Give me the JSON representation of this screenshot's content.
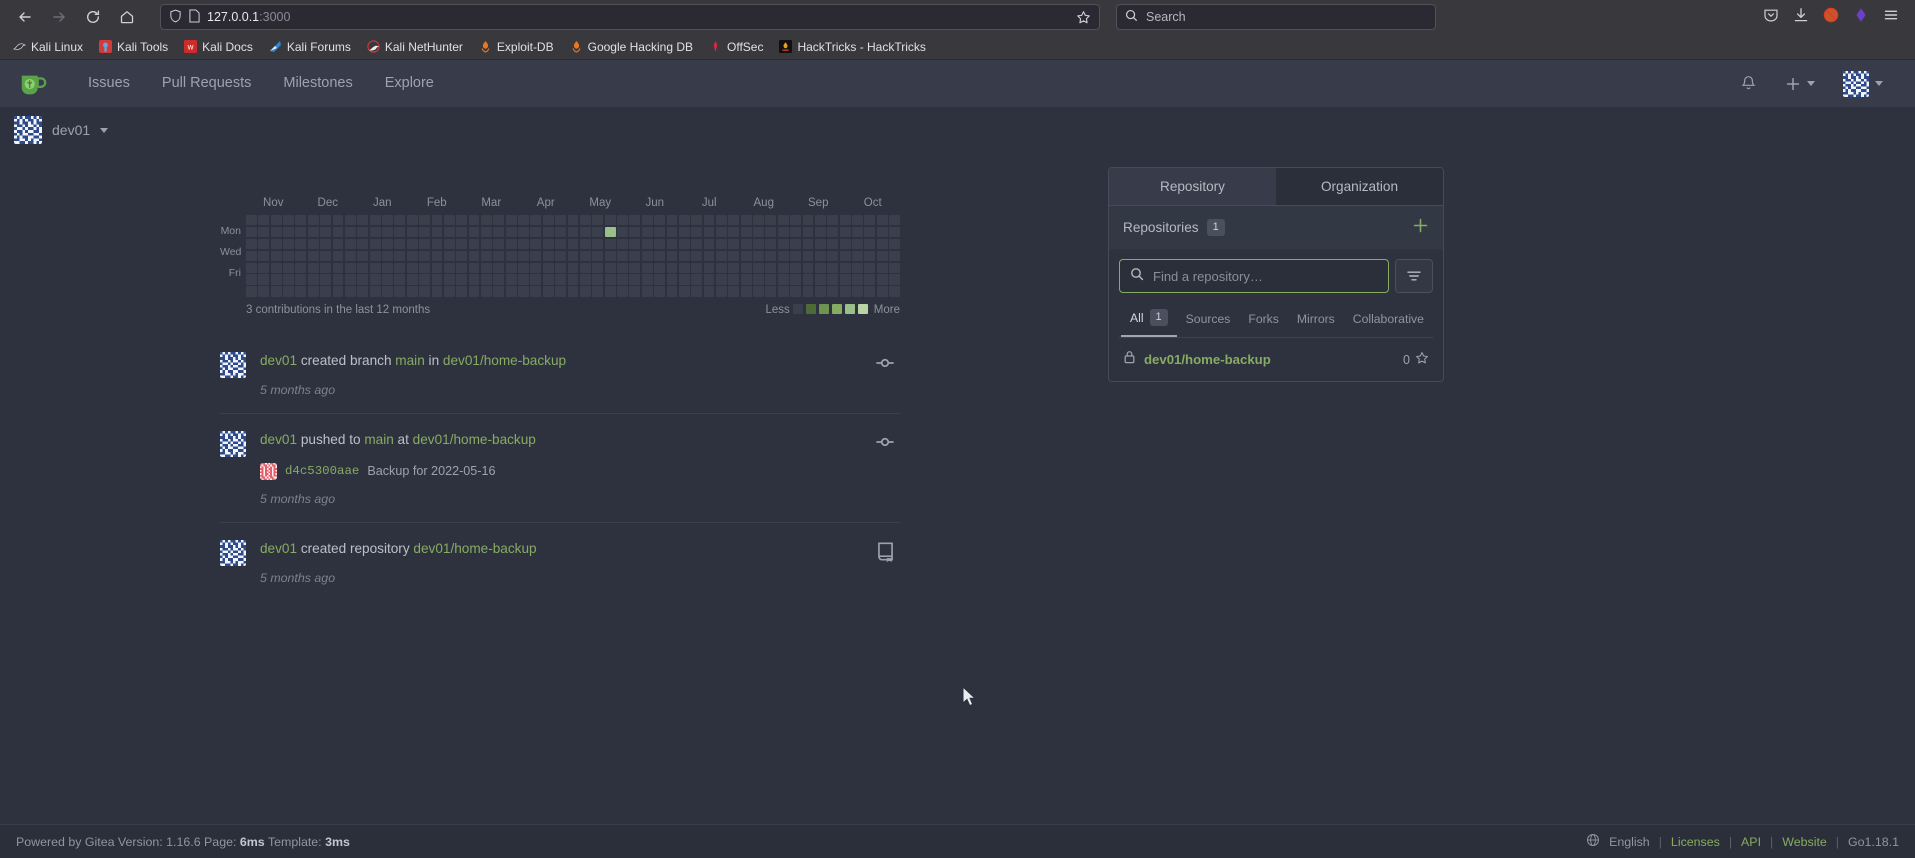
{
  "browser": {
    "nav": {
      "back": "back-arrow",
      "forward": "forward-arrow",
      "reload": "reload",
      "home": "home"
    },
    "url": {
      "host": "127.0.0.1",
      "port": ":3000",
      "shield_icon": "shield-icon",
      "page_icon": "page-icon",
      "bookmark_icon": "star-icon"
    },
    "search": {
      "placeholder": "Search",
      "icon": "search-icon"
    },
    "right_icons": [
      "pocket-icon",
      "downloads-icon",
      "noscript-icon",
      "extension-icon",
      "hamburger-menu-icon"
    ],
    "bookmarks": [
      {
        "label": "Kali Linux",
        "icon": "dragon"
      },
      {
        "label": "Kali Tools",
        "icon": "tools"
      },
      {
        "label": "Kali Docs",
        "icon": "docs"
      },
      {
        "label": "Kali Forums",
        "icon": "forums"
      },
      {
        "label": "Kali NetHunter",
        "icon": "nethunter"
      },
      {
        "label": "Exploit-DB",
        "icon": "exploitdb"
      },
      {
        "label": "Google Hacking DB",
        "icon": "ghdb"
      },
      {
        "label": "OffSec",
        "icon": "offsec"
      },
      {
        "label": "HackTricks - HackTricks",
        "icon": "hacktricks"
      }
    ]
  },
  "navbar": {
    "logo": "gitea-logo",
    "links": [
      "Issues",
      "Pull Requests",
      "Milestones",
      "Explore"
    ],
    "bell_icon": "bell-icon",
    "plus_icon": "plus-icon",
    "avatar": "user-avatar"
  },
  "userbar": {
    "username": "dev01",
    "avatar": "user-avatar"
  },
  "heatmap": {
    "months": [
      "Nov",
      "Dec",
      "Jan",
      "Feb",
      "Mar",
      "Apr",
      "May",
      "Jun",
      "Jul",
      "Aug",
      "Sep",
      "Oct"
    ],
    "day_labels": [
      "",
      "Mon",
      "",
      "Wed",
      "",
      "Fri",
      ""
    ],
    "summary": "3 contributions in the last 12 months",
    "legend_less": "Less",
    "legend_more": "More",
    "legend_colors": [
      "#3a3f4e",
      "#4e6b37",
      "#6f9450",
      "#86ab62",
      "#9ac08a",
      "#b8d4a6"
    ],
    "weeks": 53,
    "empty_color": "#3a3f4e",
    "contributions": [
      {
        "week": 29,
        "day": 1,
        "color": "#9ac08a",
        "count": 3
      }
    ]
  },
  "activity": [
    {
      "actor": "dev01",
      "action_pre": " created branch ",
      "ref": "main",
      "action_mid": " in ",
      "repo": "dev01/home-backup",
      "time": "5 months ago",
      "icon": "git-commit-icon",
      "avatar": "user-avatar-blue"
    },
    {
      "actor": "dev01",
      "action_pre": " pushed to ",
      "ref": "main",
      "action_mid": " at ",
      "repo": "dev01/home-backup",
      "commit_sha": "d4c5300aae",
      "commit_message": "Backup for 2022-05-16",
      "commit_avatar": "commit-avatar-red",
      "time": "5 months ago",
      "icon": "git-commit-icon",
      "avatar": "user-avatar-blue"
    },
    {
      "actor": "dev01",
      "action_pre": " created repository ",
      "repo": "dev01/home-backup",
      "time": "5 months ago",
      "icon": "repo-icon",
      "avatar": "user-avatar-blue"
    }
  ],
  "sidebar": {
    "tabs": [
      {
        "label": "Repository",
        "active": true
      },
      {
        "label": "Organization",
        "active": false
      }
    ],
    "repositories_title": "Repositories",
    "repositories_count": "1",
    "add_icon": "plus-icon",
    "search": {
      "placeholder": "Find a repository…",
      "value": "",
      "icon": "search-icon"
    },
    "filter_icon": "filter-icon",
    "filters": [
      {
        "label": "All",
        "count": "1",
        "active": true
      },
      {
        "label": "Sources",
        "count": "",
        "active": false
      },
      {
        "label": "Forks",
        "count": "",
        "active": false
      },
      {
        "label": "Mirrors",
        "count": "",
        "active": false
      },
      {
        "label": "Collaborative",
        "count": "",
        "active": false
      }
    ],
    "repos": [
      {
        "name": "dev01/home-backup",
        "private": true,
        "lock_icon": "lock-icon",
        "stars": "0",
        "star_icon": "star-icon"
      }
    ]
  },
  "footer": {
    "powered_prefix": "Powered by Gitea Version: 1.16.6 Page:",
    "page_time": "6ms",
    "template_label": "Template:",
    "template_time": "3ms",
    "language_icon": "globe-icon",
    "language": "English",
    "links": [
      "Licenses",
      "API",
      "Website"
    ],
    "go_version": "Go1.18.1"
  },
  "colors": {
    "accent_green": "#87ab63",
    "page_bg": "#2e323e",
    "navbar_bg": "#383c4a",
    "heatmap_cell": "#3a3f4e"
  }
}
